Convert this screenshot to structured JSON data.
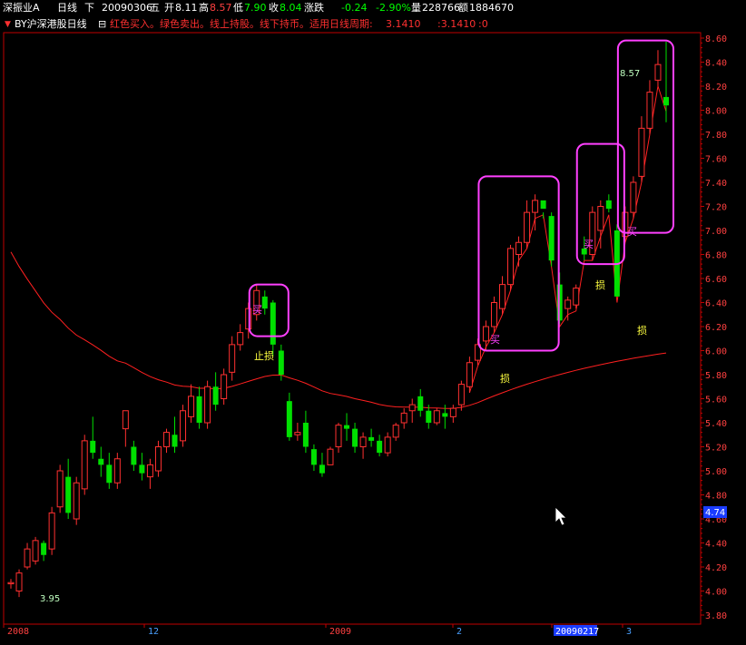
{
  "header": {
    "stock_name": "深振业A",
    "period": "日线",
    "page_down": "下",
    "date": "20090306",
    "weekday": "五",
    "open_label": "开",
    "open_value": "8.11",
    "high_label": "高",
    "high_value": "8.57",
    "low_label": "低",
    "low_value": "7.90",
    "close_label": "收",
    "close_value": "8.04",
    "change_label": "涨跌",
    "change_value": "-0.24",
    "change_pct": "-2.90%",
    "volume_label": "量",
    "volume_value": "228766",
    "amount_label": "额",
    "amount_value": "1884670"
  },
  "indicator": {
    "name": "BY沪深港股日线",
    "toggle_symbol": "⊟",
    "description": "红色买入。绿色卖出。线上持股。线下持币。适用日线周期:",
    "param1": "3.1410",
    "param2": ":3.1410",
    "param3": ":0"
  },
  "markers": {
    "buy": "买",
    "stop_loss": "止损",
    "loss": "损",
    "high_value": "8.57",
    "low_value": "3.95",
    "cursor_price": "4.74"
  },
  "x_axis_labels": [
    {
      "text": "2008",
      "color": "#ff4040"
    },
    {
      "text": "12",
      "color": "#4aa0ff"
    },
    {
      "text": "2009",
      "color": "#ff4040"
    },
    {
      "text": "2",
      "color": "#4aa0ff"
    },
    {
      "text": "20090217",
      "color": "#ffffff",
      "highlight": true
    },
    {
      "text": "3",
      "color": "#4aa0ff"
    }
  ],
  "colors": {
    "up": "#ff3030",
    "down": "#00e000",
    "ma": "#ff2020",
    "box": "#ff40ff",
    "axis": "#c00000",
    "text_price": "#ff4040"
  },
  "chart_data": {
    "type": "candlestick",
    "ylim": [
      3.8,
      8.6
    ],
    "yticks": [
      "8.60",
      "8.40",
      "8.20",
      "8.00",
      "7.80",
      "7.60",
      "7.40",
      "7.20",
      "7.00",
      "6.80",
      "6.60",
      "6.40",
      "6.20",
      "6.00",
      "5.80",
      "5.60",
      "5.40",
      "5.20",
      "5.00",
      "4.80",
      "4.60",
      "4.40",
      "4.20",
      "4.00",
      "3.80"
    ],
    "candles": [
      [
        4.06,
        4.1,
        4.02,
        4.07
      ],
      [
        4.0,
        4.18,
        3.95,
        4.15
      ],
      [
        4.2,
        4.4,
        4.18,
        4.35
      ],
      [
        4.25,
        4.45,
        4.22,
        4.42
      ],
      [
        4.4,
        4.42,
        4.25,
        4.3
      ],
      [
        4.35,
        4.7,
        4.3,
        4.65
      ],
      [
        4.7,
        5.05,
        4.65,
        5.0
      ],
      [
        4.95,
        5.1,
        4.6,
        4.65
      ],
      [
        4.6,
        4.95,
        4.55,
        4.9
      ],
      [
        4.85,
        5.3,
        4.8,
        5.25
      ],
      [
        5.25,
        5.45,
        5.1,
        5.15
      ],
      [
        5.1,
        5.2,
        4.95,
        5.05
      ],
      [
        5.05,
        5.15,
        4.85,
        4.9
      ],
      [
        4.9,
        5.15,
        4.85,
        5.1
      ],
      [
        5.35,
        5.5,
        5.2,
        5.5
      ],
      [
        5.2,
        5.25,
        5.0,
        5.05
      ],
      [
        5.05,
        5.15,
        4.92,
        4.98
      ],
      [
        4.95,
        5.1,
        4.85,
        5.05
      ],
      [
        5.0,
        5.25,
        4.95,
        5.2
      ],
      [
        5.2,
        5.35,
        5.15,
        5.32
      ],
      [
        5.3,
        5.45,
        5.15,
        5.2
      ],
      [
        5.25,
        5.55,
        5.2,
        5.5
      ],
      [
        5.45,
        5.72,
        5.4,
        5.62
      ],
      [
        5.62,
        5.7,
        5.35,
        5.4
      ],
      [
        5.4,
        5.75,
        5.35,
        5.7
      ],
      [
        5.7,
        5.82,
        5.5,
        5.55
      ],
      [
        5.6,
        5.85,
        5.55,
        5.8
      ],
      [
        5.82,
        6.12,
        5.75,
        6.05
      ],
      [
        6.05,
        6.22,
        6.0,
        6.15
      ],
      [
        6.18,
        6.4,
        6.1,
        6.35
      ],
      [
        6.3,
        6.55,
        6.25,
        6.5
      ],
      [
        6.45,
        6.5,
        6.3,
        6.35
      ],
      [
        6.4,
        6.42,
        5.95,
        6.05
      ],
      [
        6.0,
        6.05,
        5.75,
        5.8
      ],
      [
        5.58,
        5.65,
        5.25,
        5.28
      ],
      [
        5.3,
        5.4,
        5.25,
        5.32
      ],
      [
        5.4,
        5.5,
        5.15,
        5.2
      ],
      [
        5.18,
        5.22,
        5.0,
        5.05
      ],
      [
        5.05,
        5.15,
        4.95,
        4.98
      ],
      [
        5.05,
        5.2,
        5.05,
        5.18
      ],
      [
        5.2,
        5.4,
        5.15,
        5.38
      ],
      [
        5.38,
        5.48,
        5.25,
        5.35
      ],
      [
        5.35,
        5.4,
        5.15,
        5.2
      ],
      [
        5.2,
        5.32,
        5.1,
        5.28
      ],
      [
        5.28,
        5.35,
        5.2,
        5.25
      ],
      [
        5.25,
        5.3,
        5.12,
        5.15
      ],
      [
        5.15,
        5.32,
        5.12,
        5.28
      ],
      [
        5.28,
        5.4,
        5.25,
        5.38
      ],
      [
        5.4,
        5.52,
        5.35,
        5.48
      ],
      [
        5.5,
        5.6,
        5.4,
        5.55
      ],
      [
        5.62,
        5.68,
        5.45,
        5.5
      ],
      [
        5.5,
        5.55,
        5.35,
        5.4
      ],
      [
        5.4,
        5.52,
        5.38,
        5.5
      ],
      [
        5.48,
        5.55,
        5.35,
        5.45
      ],
      [
        5.45,
        5.55,
        5.4,
        5.52
      ],
      [
        5.55,
        5.75,
        5.5,
        5.72
      ],
      [
        5.7,
        5.95,
        5.65,
        5.9
      ],
      [
        5.92,
        6.1,
        5.88,
        6.05
      ],
      [
        6.08,
        6.25,
        6.0,
        6.2
      ],
      [
        6.2,
        6.45,
        6.15,
        6.4
      ],
      [
        6.35,
        6.62,
        6.3,
        6.55
      ],
      [
        6.55,
        6.88,
        6.5,
        6.85
      ],
      [
        6.8,
        6.95,
        6.7,
        6.9
      ],
      [
        6.9,
        7.25,
        6.85,
        7.15
      ],
      [
        7.15,
        7.3,
        7.0,
        7.25
      ],
      [
        7.25,
        7.15,
        7.1,
        7.18
      ],
      [
        7.12,
        7.15,
        6.7,
        6.75
      ],
      [
        6.55,
        6.65,
        6.22,
        6.25
      ],
      [
        6.35,
        6.45,
        6.25,
        6.42
      ],
      [
        6.38,
        6.55,
        6.35,
        6.52
      ],
      [
        6.85,
        6.95,
        6.75,
        6.8
      ],
      [
        6.8,
        7.2,
        6.75,
        7.15
      ],
      [
        7.0,
        7.25,
        6.85,
        7.2
      ],
      [
        7.25,
        7.3,
        7.15,
        7.18
      ],
      [
        7.0,
        7.05,
        6.45,
        6.45
      ],
      [
        6.95,
        7.2,
        6.9,
        7.15
      ],
      [
        7.15,
        7.45,
        7.1,
        7.4
      ],
      [
        7.45,
        7.95,
        7.4,
        7.85
      ],
      [
        7.85,
        8.25,
        7.8,
        8.15
      ],
      [
        8.25,
        8.5,
        8.2,
        8.38
      ],
      [
        8.11,
        8.57,
        7.9,
        8.04
      ]
    ]
  }
}
